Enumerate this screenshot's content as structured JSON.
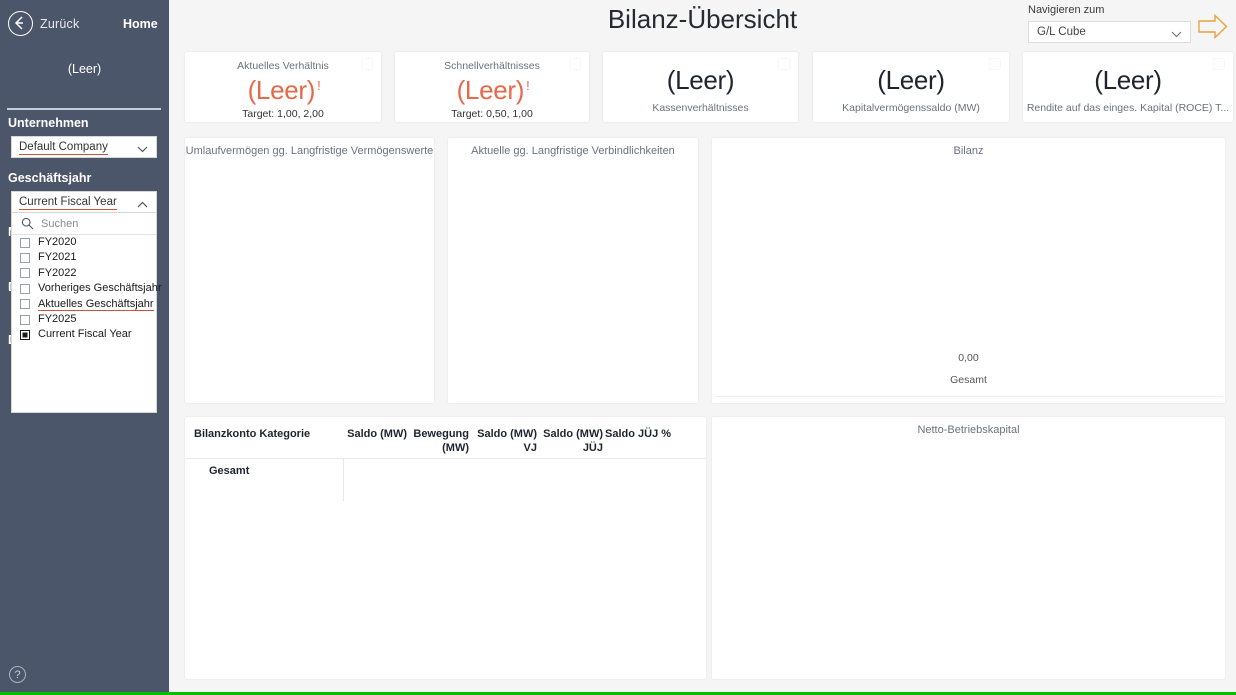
{
  "sidebar": {
    "back_label": "Zurück",
    "home_label": "Home",
    "header_value": "(Leer)",
    "company_label": "Unternehmen",
    "company_value": "Default Company",
    "fiscal_year_label": "Geschäftsjahr",
    "fiscal_year_value": "Current Fiscal Year",
    "hidden_label_m": "M",
    "hidden_label_d1": "D",
    "hidden_label_d2": "D",
    "help_glyph": "?",
    "slicer": {
      "search_placeholder": "Suchen",
      "items": [
        {
          "label": "FY2020",
          "checked": false,
          "highlight": false
        },
        {
          "label": "FY2021",
          "checked": false,
          "highlight": false
        },
        {
          "label": "FY2022",
          "checked": false,
          "highlight": false
        },
        {
          "label": "Vorheriges Geschäftsjahr",
          "checked": false,
          "highlight": false
        },
        {
          "label": "Aktuelles Geschäftsjahr",
          "checked": false,
          "highlight": true
        },
        {
          "label": "FY2025",
          "checked": false,
          "highlight": false
        },
        {
          "label": "Current Fiscal Year",
          "checked": true,
          "highlight": false
        }
      ]
    }
  },
  "header": {
    "title": "Bilanz-Übersicht",
    "navigate_label": "Navigieren zum",
    "navigate_value": "G/L Cube"
  },
  "kpis": [
    {
      "caption": "Aktuelles Verhältnis",
      "value": "(Leer)",
      "bang": "!",
      "target": "Target: 1,00, 2,00",
      "alert": true
    },
    {
      "caption": "Schnellverhältnisses",
      "value": "(Leer)",
      "bang": "!",
      "target": "Target: 0,50, 1,00",
      "alert": true
    },
    {
      "caption": "Kassenverhältnisses",
      "value": "(Leer)",
      "bang": "",
      "target": "",
      "alert": false
    },
    {
      "caption": "Kapitalvermögenssaldo (MW)",
      "value": "(Leer)",
      "bang": "",
      "target": "",
      "alert": false
    },
    {
      "caption": "Rendite auf das einges. Kapital (ROCE) T...",
      "value": "(Leer)",
      "bang": "",
      "target": "",
      "alert": false
    }
  ],
  "panels": {
    "p1_title": "Umlaufvermögen gg. Langfristige Vermögenswerte",
    "p2_title": "Aktuelle gg. Langfristige Verbindlichkeiten",
    "p3_title": "Bilanz",
    "p3_total_value": "0,00",
    "p3_axis_label": "Gesamt",
    "p5_title": "Netto-Betriebskapital"
  },
  "table": {
    "headers": [
      "Bilanzkonto Kategorie",
      "Saldo (MW)",
      "Bewegung (MW)",
      "Saldo (MW) VJ",
      "Saldo (MW) JÜJ",
      "Saldo JÜJ %"
    ],
    "total_row_label": "Gesamt"
  },
  "chart_data": [
    {
      "type": "bar",
      "title": "Umlaufvermögen gg. Langfristige Vermögenswerte",
      "categories": [],
      "values": [],
      "xlabel": "",
      "ylabel": ""
    },
    {
      "type": "bar",
      "title": "Aktuelle gg. Langfristige Verbindlichkeiten",
      "categories": [],
      "values": [],
      "xlabel": "",
      "ylabel": ""
    },
    {
      "type": "bar",
      "title": "Bilanz",
      "categories": [
        "Gesamt"
      ],
      "values": [
        0.0
      ],
      "value_labels": [
        "0,00"
      ],
      "xlabel": "",
      "ylabel": ""
    },
    {
      "type": "table",
      "title": "Bilanzkonto Kategorie",
      "columns": [
        "Bilanzkonto Kategorie",
        "Saldo (MW)",
        "Bewegung (MW)",
        "Saldo (MW) VJ",
        "Saldo (MW) JÜJ",
        "Saldo JÜJ %"
      ],
      "rows": [
        [
          "Gesamt",
          "",
          "",
          "",
          "",
          ""
        ]
      ]
    },
    {
      "type": "bar",
      "title": "Netto-Betriebskapital",
      "categories": [],
      "values": [],
      "xlabel": "",
      "ylabel": ""
    }
  ],
  "colors": {
    "sidebar_bg": "#4c566b",
    "alert": "#e8684a",
    "underline": "#c8553a",
    "status_bar": "#00c000"
  }
}
